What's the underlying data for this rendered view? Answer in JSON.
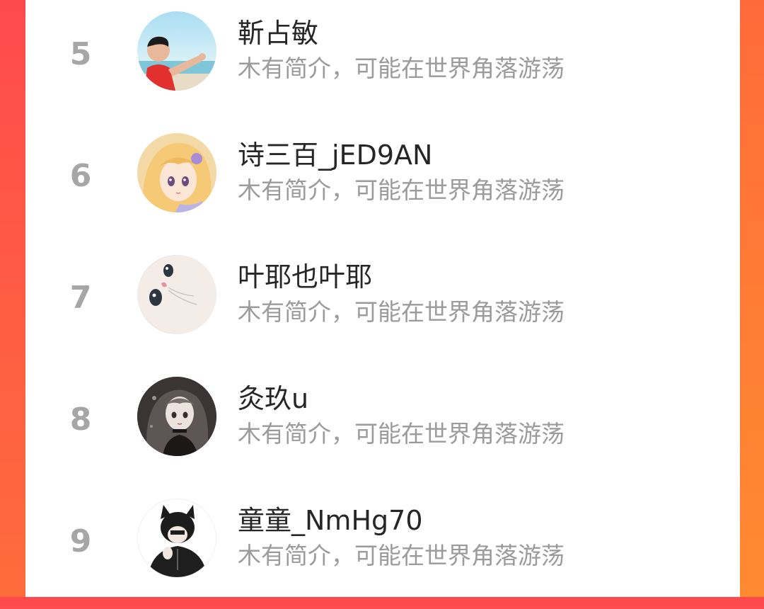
{
  "users": [
    {
      "rank": "5",
      "name": "靳占敏",
      "bio": "木有简介，可能在世界角落游荡",
      "avatar": "avatar-man-beach"
    },
    {
      "rank": "6",
      "name": "诗三百_jED9AN",
      "bio": "木有简介，可能在世界角落游荡",
      "avatar": "avatar-anime-girl-blonde"
    },
    {
      "rank": "7",
      "name": "叶耶也叶耶",
      "bio": "木有简介，可能在世界角落游荡",
      "avatar": "avatar-white-cat"
    },
    {
      "rank": "8",
      "name": "灸玖u",
      "bio": "木有简介，可能在世界角落游荡",
      "avatar": "avatar-anime-girl-dark"
    },
    {
      "rank": "9",
      "name": "童童_NmHg70",
      "bio": "木有简介，可能在世界角落游荡",
      "avatar": "avatar-cat-ear-boy"
    }
  ],
  "colors": {
    "background_left": "#ff4a4d",
    "background_right": "#ff7e34",
    "rank": "#a6a6a6",
    "name": "#262626",
    "bio": "#9b9b9b"
  }
}
